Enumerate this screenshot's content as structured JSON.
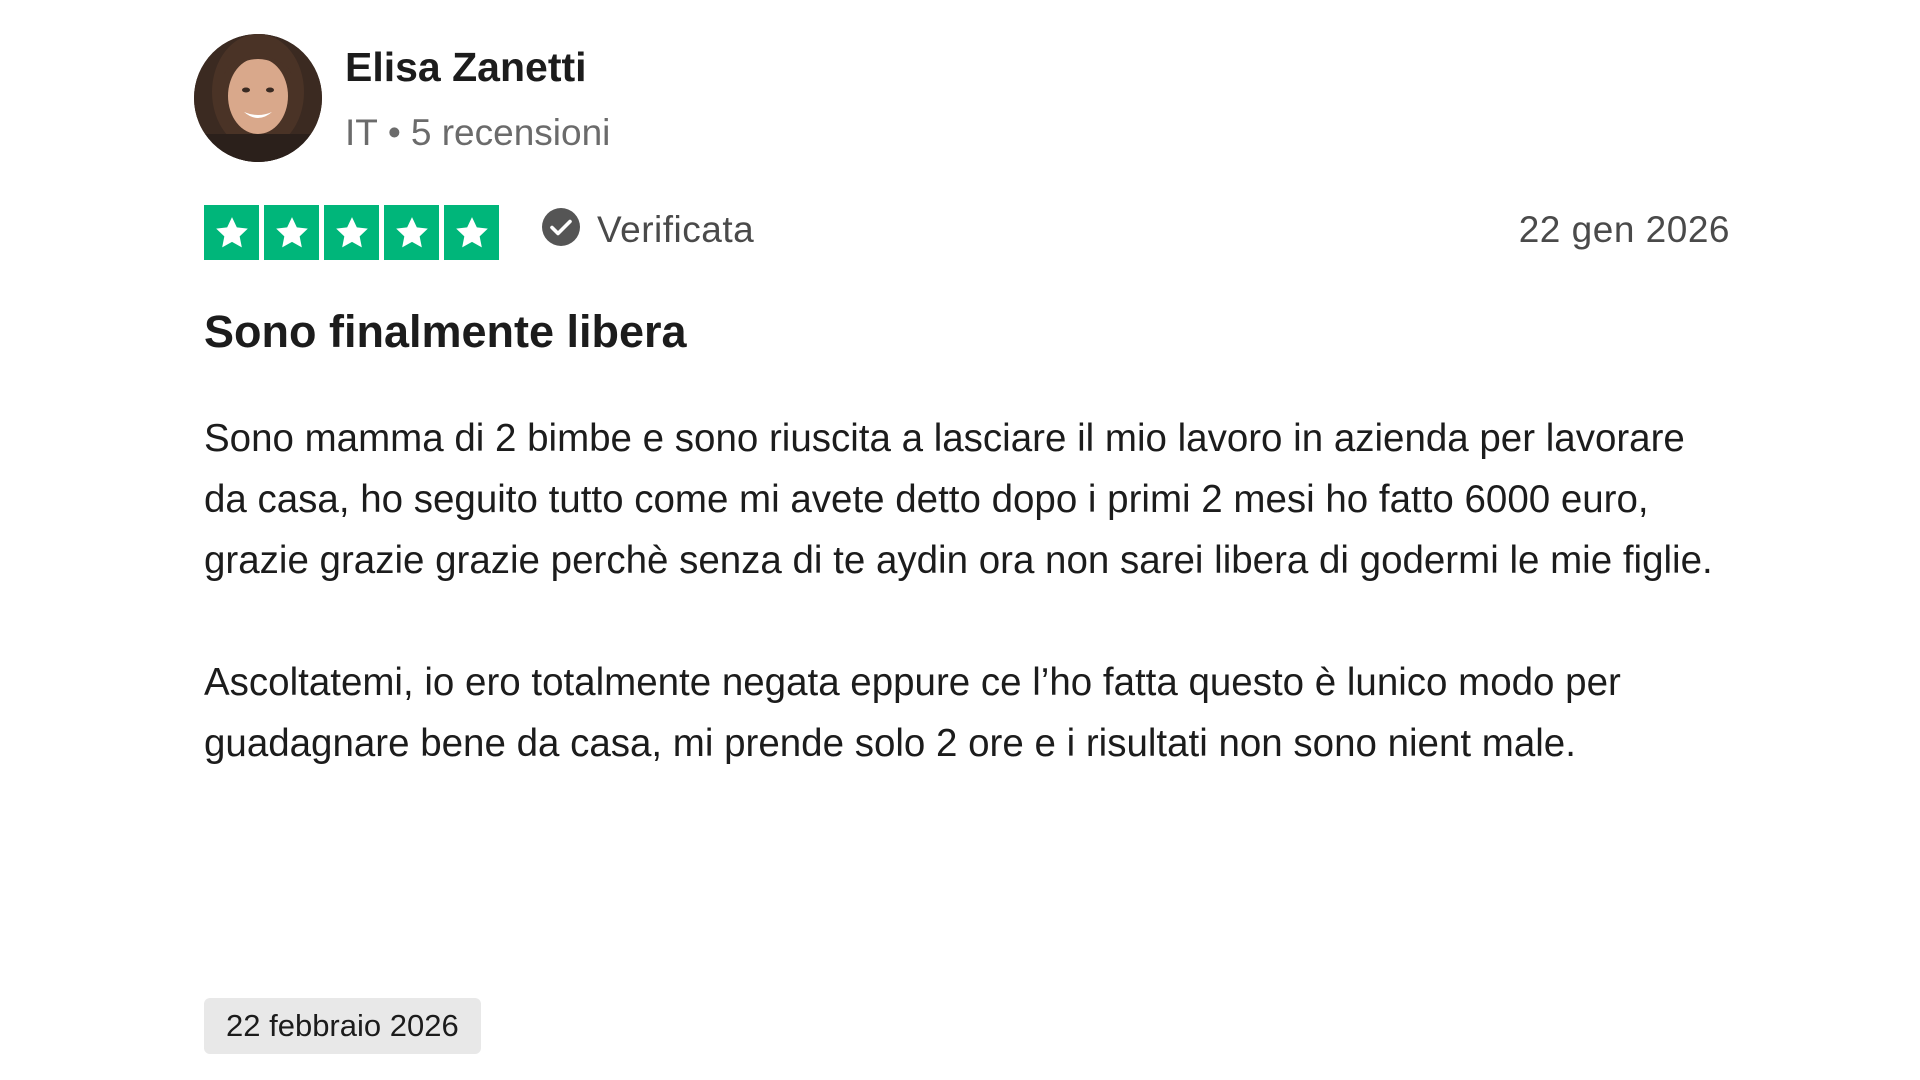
{
  "reviewer": {
    "name": "Elisa Zanetti",
    "country": "IT",
    "separator": "•",
    "reviews_count": "5 recensioni"
  },
  "rating": {
    "stars": 5,
    "max_stars": 5,
    "star_color": "#00b67a",
    "star_icon": "star-icon"
  },
  "verification": {
    "label": "Verificata",
    "icon": "check-circle-icon"
  },
  "review": {
    "date": "22 gen 2026",
    "title": "Sono finalmente libera",
    "paragraphs": [
      "Sono mamma di 2 bimbe e sono riuscita a lasciare il mio lavoro in azienda per lavorare da casa, ho seguito tutto come mi avete detto dopo i primi 2 mesi ho fatto 6000 euro, grazie grazie grazie perchè senza di te aydin ora non sarei libera di godermi le mie figlie.",
      "Ascoltatemi, io ero totalmente negata eppure ce l’ho fatta questo è lunico modo per guadagnare bene da casa, mi prende solo 2 ore e i risultati non sono  nient male."
    ],
    "experience_date": "22 febbraio 2026"
  }
}
